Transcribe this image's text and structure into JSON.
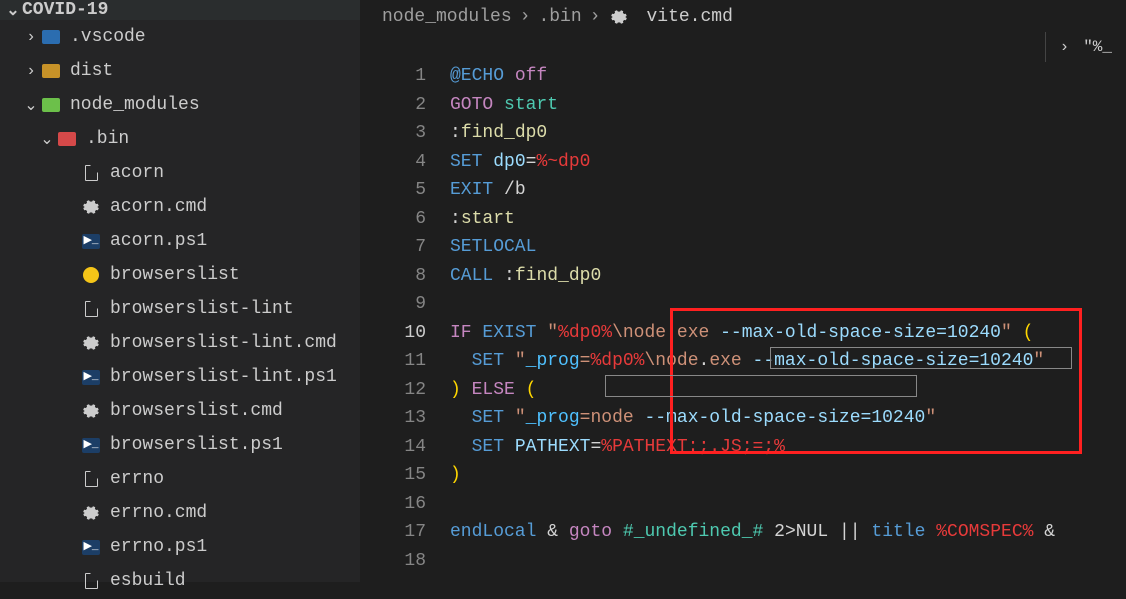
{
  "sidebar": {
    "title": "COVID-19",
    "items": [
      {
        "label": ".vscode",
        "depth": 1,
        "chevron": ">",
        "icon": "folder-vscode"
      },
      {
        "label": "dist",
        "depth": 1,
        "chevron": ">",
        "icon": "folder-dist"
      },
      {
        "label": "node_modules",
        "depth": 1,
        "chevron": "v",
        "icon": "folder-node"
      },
      {
        "label": ".bin",
        "depth": 2,
        "chevron": "v",
        "icon": "folder-bin"
      },
      {
        "label": "acorn",
        "depth": 3,
        "chevron": "",
        "icon": "file"
      },
      {
        "label": "acorn.cmd",
        "depth": 3,
        "chevron": "",
        "icon": "gear"
      },
      {
        "label": "acorn.ps1",
        "depth": 3,
        "chevron": "",
        "icon": "ps1"
      },
      {
        "label": "browserslist",
        "depth": 3,
        "chevron": "",
        "icon": "browserslist"
      },
      {
        "label": "browserslist-lint",
        "depth": 3,
        "chevron": "",
        "icon": "file"
      },
      {
        "label": "browserslist-lint.cmd",
        "depth": 3,
        "chevron": "",
        "icon": "gear"
      },
      {
        "label": "browserslist-lint.ps1",
        "depth": 3,
        "chevron": "",
        "icon": "ps1"
      },
      {
        "label": "browserslist.cmd",
        "depth": 3,
        "chevron": "",
        "icon": "gear"
      },
      {
        "label": "browserslist.ps1",
        "depth": 3,
        "chevron": "",
        "icon": "ps1"
      },
      {
        "label": "errno",
        "depth": 3,
        "chevron": "",
        "icon": "file"
      },
      {
        "label": "errno.cmd",
        "depth": 3,
        "chevron": "",
        "icon": "gear"
      },
      {
        "label": "errno.ps1",
        "depth": 3,
        "chevron": "",
        "icon": "ps1"
      },
      {
        "label": "esbuild",
        "depth": 3,
        "chevron": "",
        "icon": "file"
      }
    ]
  },
  "breadcrumb": {
    "parts": [
      "node_modules",
      ".bin",
      "vite.cmd"
    ]
  },
  "topright_hint": "\"%_",
  "code": {
    "lines": [
      "@ECHO off",
      "GOTO start",
      ":find_dp0",
      "SET dp0=%~dp0",
      "EXIT /b",
      ":start",
      "SETLOCAL",
      "CALL :find_dp0",
      "",
      "IF EXIST \"%dp0%\\node.exe --max-old-space-size=10240\" (",
      "  SET \"_prog=%dp0%\\node.exe --max-old-space-size=10240\"",
      ") ELSE (",
      "  SET \"_prog=node --max-old-space-size=10240\"",
      "  SET PATHEXT=%PATHEXT:;.JS;=;%",
      ")",
      "",
      "endLocal & goto #_undefined_# 2>NUL || title %COMSPEC% &",
      ""
    ]
  }
}
